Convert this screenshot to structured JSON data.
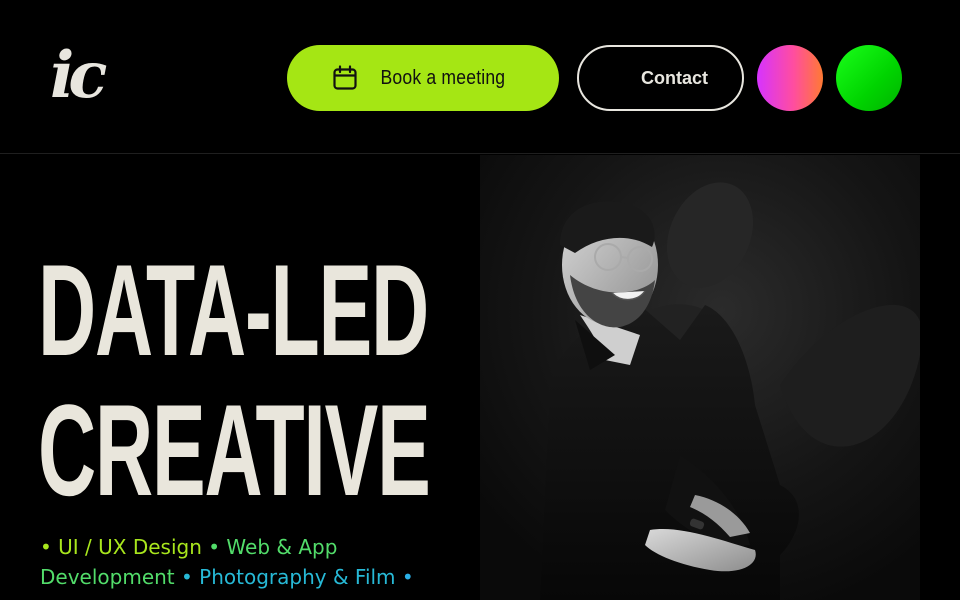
{
  "header": {
    "logo_text": "ic",
    "book_button": {
      "label": "Book a meeting",
      "icon": "calendar-icon"
    },
    "contact_button": {
      "label": "Contact"
    }
  },
  "hero": {
    "title_line_1": "DATA-LED",
    "title_line_2": "CREATIVE",
    "services": [
      "• UI / UX Design",
      " • Web & App Development",
      " • Photography & Film",
      " •"
    ]
  },
  "colors": {
    "background": "#000000",
    "accent_lime": "#a5e614",
    "text_cream": "#e9e6dc",
    "theme_dot_gradient": "#d633ff-#ff7a33",
    "theme_dot_green": "#00d400"
  },
  "photo": {
    "subject": "portrait-photo"
  }
}
